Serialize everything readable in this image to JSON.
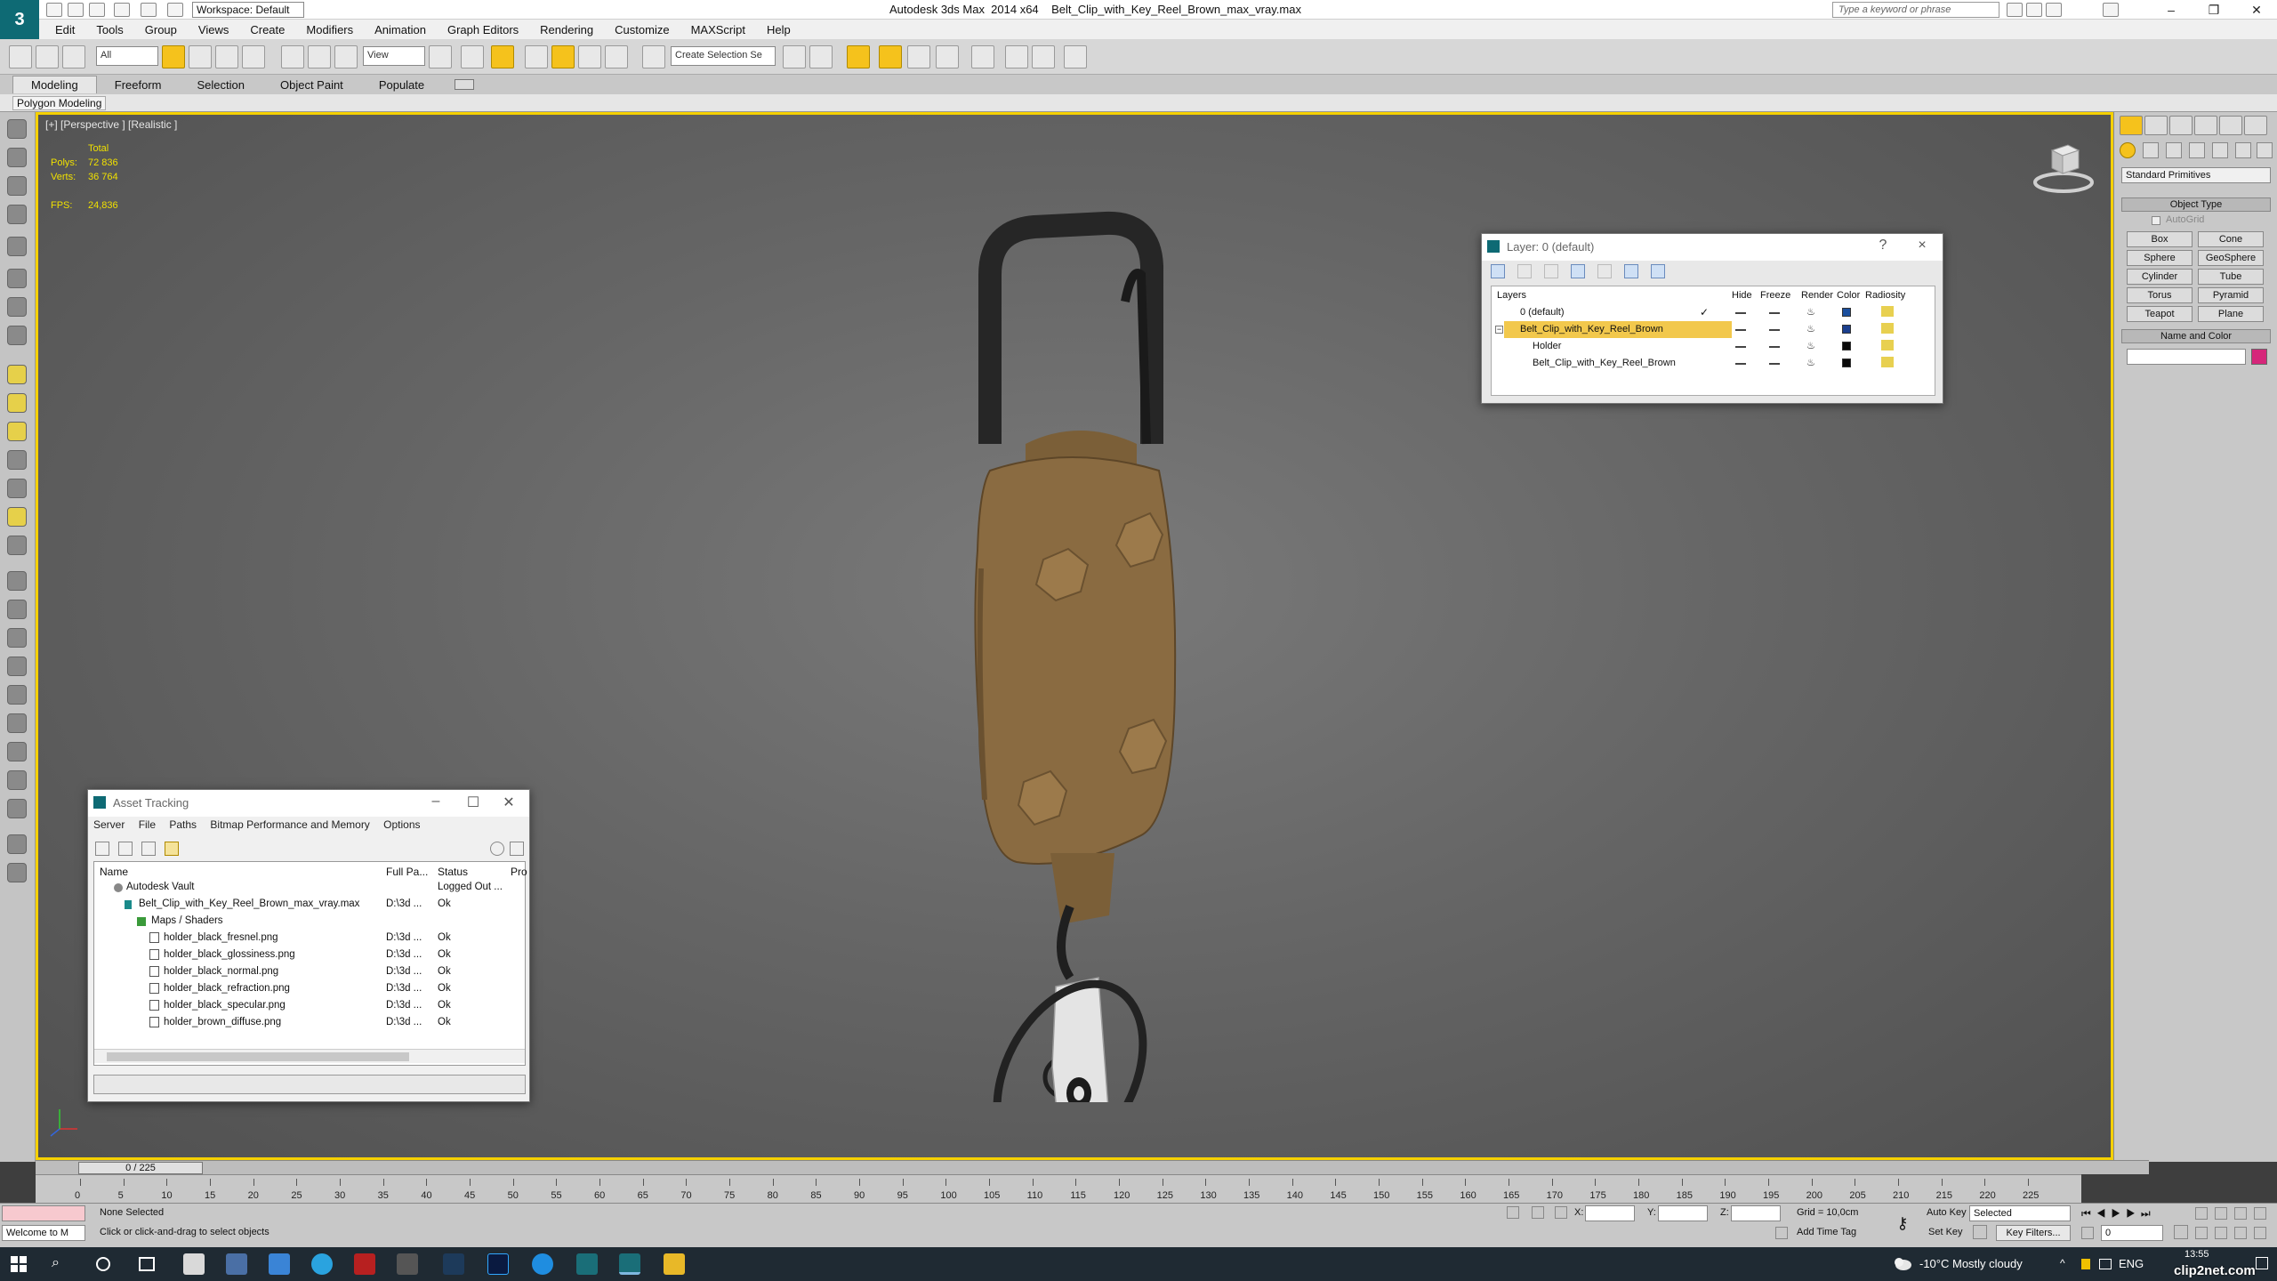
{
  "app": {
    "logo_text": "3",
    "window_title": "Autodesk 3ds Max  2014 x64    Belt_Clip_with_Key_Reel_Brown_max_vray.max",
    "workspace": "Workspace: Default",
    "search_placeholder": "Type a keyword or phrase"
  },
  "menu": [
    "Edit",
    "Tools",
    "Group",
    "Views",
    "Create",
    "Modifiers",
    "Animation",
    "Graph Editors",
    "Rendering",
    "Customize",
    "MAXScript",
    "Help"
  ],
  "toolbar": {
    "filter_value": "All",
    "refcoord_value": "View",
    "selection_set_placeholder": "Create Selection Se"
  },
  "ribbon": {
    "tabs": [
      "Modeling",
      "Freeform",
      "Selection",
      "Object Paint",
      "Populate"
    ],
    "active_tab": "Modeling",
    "sub_label": "Polygon Modeling"
  },
  "viewport": {
    "label": "[+] [Perspective ] [Realistic ]",
    "stats": {
      "total_label": "Total",
      "polys_label": "Polys:",
      "polys_value": "72 836",
      "verts_label": "Verts:",
      "verts_value": "36 764",
      "fps_label": "FPS:",
      "fps_value": "24,836"
    }
  },
  "command_panel": {
    "dropdown": "Standard Primitives",
    "object_type_title": "Object Type",
    "autogrid_label": "AutoGrid",
    "buttons": [
      "Box",
      "Cone",
      "Sphere",
      "GeoSphere",
      "Cylinder",
      "Tube",
      "Torus",
      "Pyramid",
      "Teapot",
      "Plane"
    ],
    "name_color_title": "Name and Color",
    "color": "#d6267a"
  },
  "layer_dialog": {
    "title": "Layer: 0 (default)",
    "help": "?",
    "close": "×",
    "columns": [
      "Layers",
      "Hide",
      "Freeze",
      "Render",
      "Color",
      "Radiosity"
    ],
    "rows": [
      {
        "name": "0 (default)",
        "color": "#1b4f9e",
        "selected": false,
        "checked": true
      },
      {
        "name": "Belt_Clip_with_Key_Reel_Brown",
        "color": "#1b3f8e",
        "selected": true,
        "checked": false
      },
      {
        "name": "Holder",
        "color": "#0a0a0a",
        "selected": false,
        "checked": false
      },
      {
        "name": "Belt_Clip_with_Key_Reel_Brown",
        "color": "#0a0a0a",
        "selected": false,
        "checked": false
      }
    ]
  },
  "asset_dialog": {
    "title": "Asset Tracking",
    "menu": [
      "Server",
      "File",
      "Paths",
      "Bitmap Performance and Memory",
      "Options"
    ],
    "columns": [
      "Name",
      "Full Pa...",
      "Status",
      "Pro"
    ],
    "rows": [
      {
        "name": "Autodesk Vault",
        "path": "",
        "status": "Logged Out ..."
      },
      {
        "name": "Belt_Clip_with_Key_Reel_Brown_max_vray.max",
        "path": "D:\\3d ...",
        "status": "Ok"
      },
      {
        "name": "Maps / Shaders",
        "path": "",
        "status": ""
      },
      {
        "name": "holder_black_fresnel.png",
        "path": "D:\\3d ...",
        "status": "Ok"
      },
      {
        "name": "holder_black_glossiness.png",
        "path": "D:\\3d ...",
        "status": "Ok"
      },
      {
        "name": "holder_black_normal.png",
        "path": "D:\\3d ...",
        "status": "Ok"
      },
      {
        "name": "holder_black_refraction.png",
        "path": "D:\\3d ...",
        "status": "Ok"
      },
      {
        "name": "holder_black_specular.png",
        "path": "D:\\3d ...",
        "status": "Ok"
      },
      {
        "name": "holder_brown_diffuse.png",
        "path": "D:\\3d ...",
        "status": "Ok"
      }
    ]
  },
  "timeline": {
    "frame_display": "0 / 225",
    "ticks": [
      "0",
      "5",
      "10",
      "15",
      "20",
      "25",
      "30",
      "35",
      "40",
      "45",
      "50",
      "55",
      "60",
      "65",
      "70",
      "75",
      "80",
      "85",
      "90",
      "95",
      "100",
      "105",
      "110",
      "115",
      "120",
      "125",
      "130",
      "135",
      "140",
      "145",
      "150",
      "155",
      "160",
      "165",
      "170",
      "175",
      "180",
      "185",
      "190",
      "195",
      "200",
      "205",
      "210",
      "215",
      "220",
      "225"
    ]
  },
  "status": {
    "listener": "Welcome to M",
    "selection": "None Selected",
    "prompt": "Click or click-and-drag to select objects",
    "x_label": "X:",
    "y_label": "Y:",
    "z_label": "Z:",
    "grid": "Grid = 10,0cm",
    "add_time_tag": "Add Time Tag",
    "auto_key": "Auto Key",
    "set_key": "Set Key",
    "selected_dropdown": "Selected",
    "key_filters": "Key Filters...",
    "frame_field": "0"
  },
  "taskbar": {
    "weather": "-10°C  Mostly cloudy",
    "lang": "ENG",
    "time": "13:55",
    "watermark": "clip2net.com"
  }
}
